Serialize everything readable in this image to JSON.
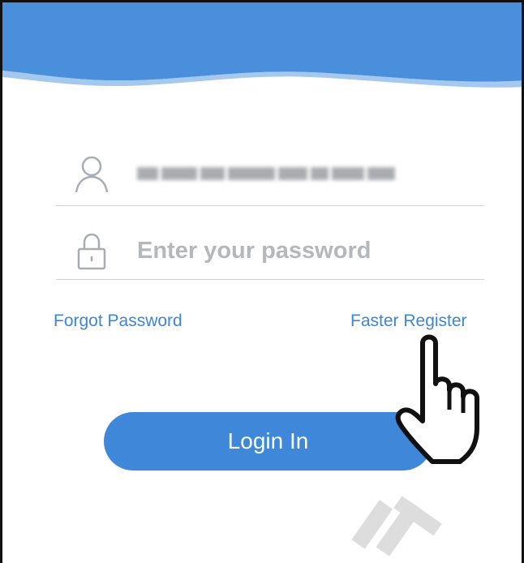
{
  "login": {
    "username_value": "",
    "password_placeholder": "Enter your password",
    "forgot_password_label": "Forgot Password",
    "faster_register_label": "Faster Register",
    "login_button_label": "Login In"
  },
  "colors": {
    "header_blue": "#4a8fdc",
    "link_blue": "#3d85d6",
    "button_blue": "#3f87d8",
    "divider": "#cfd3d8",
    "placeholder": "#b4b7bb"
  },
  "icons": {
    "user": "user-icon",
    "lock": "lock-icon",
    "pointer": "hand-pointer-icon"
  }
}
